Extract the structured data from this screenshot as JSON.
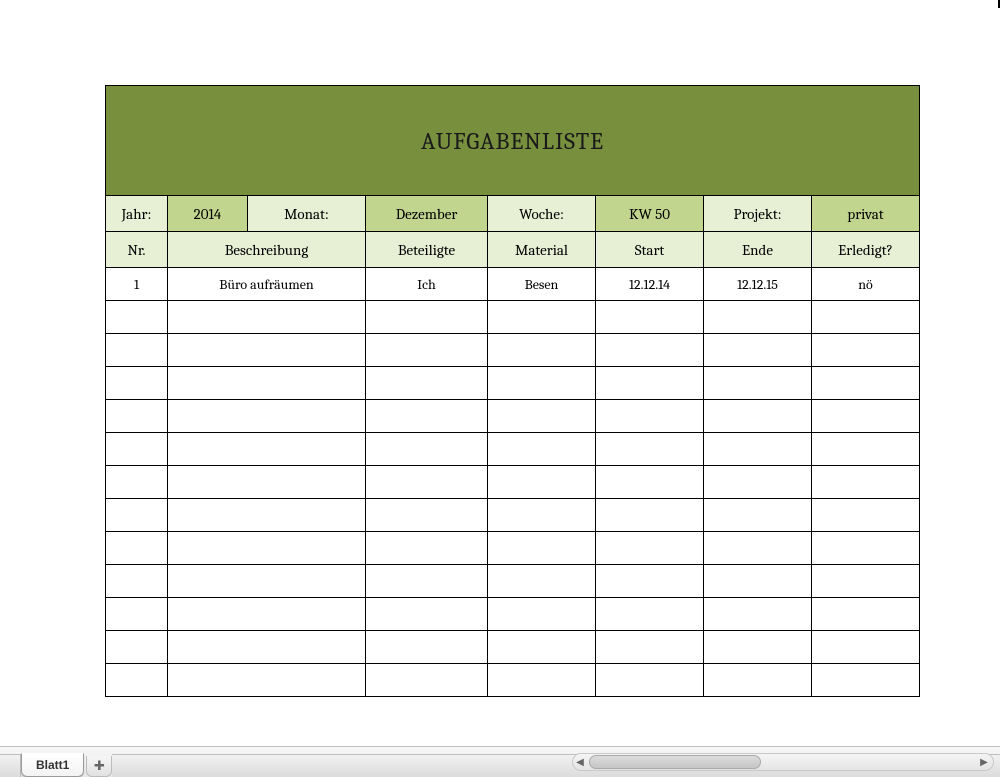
{
  "title": "AUFGABENLISTE",
  "meta": {
    "jahr_label": "Jahr:",
    "jahr_value": "2014",
    "monat_label": "Monat:",
    "monat_value": "Dezember",
    "woche_label": "Woche:",
    "woche_value": "KW 50",
    "projekt_label": "Projekt:",
    "projekt_value": "privat"
  },
  "headers": {
    "nr": "Nr.",
    "beschreibung": "Beschreibung",
    "beteiligte": "Beteiligte",
    "material": "Material",
    "start": "Start",
    "ende": "Ende",
    "erledigt": "Erledigt?"
  },
  "rows": [
    {
      "nr": "1",
      "beschreibung": "Büro aufräumen",
      "beteiligte": "Ich",
      "material": "Besen",
      "start": "12.12.14",
      "ende": "12.12.15",
      "erledigt": "nö"
    },
    {
      "nr": "",
      "beschreibung": "",
      "beteiligte": "",
      "material": "",
      "start": "",
      "ende": "",
      "erledigt": ""
    },
    {
      "nr": "",
      "beschreibung": "",
      "beteiligte": "",
      "material": "",
      "start": "",
      "ende": "",
      "erledigt": ""
    },
    {
      "nr": "",
      "beschreibung": "",
      "beteiligte": "",
      "material": "",
      "start": "",
      "ende": "",
      "erledigt": ""
    },
    {
      "nr": "",
      "beschreibung": "",
      "beteiligte": "",
      "material": "",
      "start": "",
      "ende": "",
      "erledigt": ""
    },
    {
      "nr": "",
      "beschreibung": "",
      "beteiligte": "",
      "material": "",
      "start": "",
      "ende": "",
      "erledigt": ""
    },
    {
      "nr": "",
      "beschreibung": "",
      "beteiligte": "",
      "material": "",
      "start": "",
      "ende": "",
      "erledigt": ""
    },
    {
      "nr": "",
      "beschreibung": "",
      "beteiligte": "",
      "material": "",
      "start": "",
      "ende": "",
      "erledigt": ""
    },
    {
      "nr": "",
      "beschreibung": "",
      "beteiligte": "",
      "material": "",
      "start": "",
      "ende": "",
      "erledigt": ""
    },
    {
      "nr": "",
      "beschreibung": "",
      "beteiligte": "",
      "material": "",
      "start": "",
      "ende": "",
      "erledigt": ""
    },
    {
      "nr": "",
      "beschreibung": "",
      "beteiligte": "",
      "material": "",
      "start": "",
      "ende": "",
      "erledigt": ""
    },
    {
      "nr": "",
      "beschreibung": "",
      "beteiligte": "",
      "material": "",
      "start": "",
      "ende": "",
      "erledigt": ""
    },
    {
      "nr": "",
      "beschreibung": "",
      "beteiligte": "",
      "material": "",
      "start": "",
      "ende": "",
      "erledigt": ""
    }
  ],
  "sheet_tab": "Blatt1",
  "add_tab_glyph": "✚"
}
